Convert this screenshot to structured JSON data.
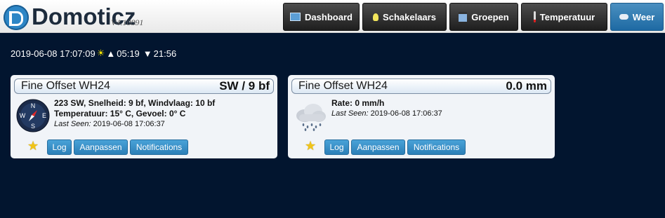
{
  "header": {
    "logo_text": "Domoticz",
    "version": "V4.10891",
    "nav": [
      {
        "label": "Dashboard",
        "icon": "dashboard-icon"
      },
      {
        "label": "Schakelaars",
        "icon": "lightbulb-icon"
      },
      {
        "label": "Groepen",
        "icon": "group-icon"
      },
      {
        "label": "Temperatuur",
        "icon": "thermometer-icon"
      },
      {
        "label": "Weer",
        "icon": "weather-cloud-icon",
        "active": true
      }
    ]
  },
  "timebar": {
    "datetime": "2019-06-08 17:07:09",
    "sunrise": "05:19",
    "sunset": "21:56",
    "sunrise_prefix": "▲",
    "sunset_prefix": "▼"
  },
  "cards": [
    {
      "title": "Fine Offset WH24",
      "value": "SW / 9 bf",
      "icon": "compass-icon",
      "line1": "223 SW, Snelheid: 9 bf, Windvlaag: 10 bf",
      "line2": "Temperatuur: 15° C, Gevoel: 0° C",
      "last_seen_label": "Last Seen:",
      "last_seen": "2019-06-08 17:06:37",
      "buttons": {
        "log": "Log",
        "edit": "Aanpassen",
        "notifications": "Notifications"
      }
    },
    {
      "title": "Fine Offset WH24",
      "value": "0.0 mm",
      "icon": "rain-cloud-icon",
      "line1": "Rate: 0 mm/h",
      "last_seen_label": "Last Seen:",
      "last_seen": "2019-06-08 17:06:37",
      "buttons": {
        "log": "Log",
        "edit": "Aanpassen",
        "notifications": "Notifications"
      }
    }
  ],
  "colors": {
    "background": "#02152f",
    "nav_active": "#2e78b0",
    "button_blue": "#3a90c8",
    "star": "#f0c419"
  }
}
